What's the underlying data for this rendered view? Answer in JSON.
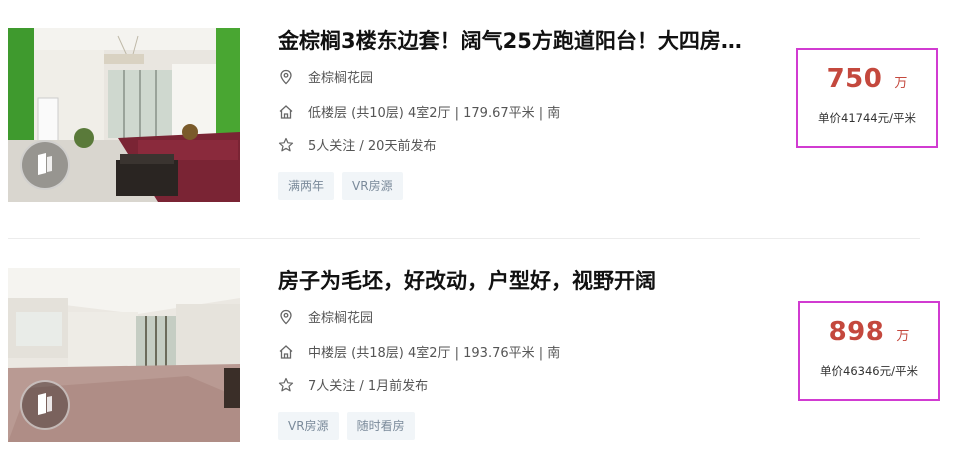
{
  "listings": [
    {
      "title": "金棕榈3楼东边套！阔气25方跑道阳台！大四房…",
      "community": "金棕榈花园",
      "house_info": "低楼层 (共10层) 4室2厅 | 179.67平米 | 南",
      "follow_info": "5人关注 / 20天前发布",
      "tags": [
        "满两年",
        "VR房源"
      ],
      "total_price": "750",
      "total_unit": "万",
      "unit_price": "单价41744元/平米"
    },
    {
      "title": "房子为毛坯，好改动，户型好，视野开阔",
      "community": "金棕榈花园",
      "house_info": "中楼层 (共18层) 4室2厅 | 193.76平米 | 南",
      "follow_info": "7人关注 / 1月前发布",
      "tags": [
        "VR房源",
        "随时看房"
      ],
      "total_price": "898",
      "total_unit": "万",
      "unit_price": "单价46346元/平米"
    }
  ],
  "colors": {
    "price": "#c4483d",
    "highlight_box": "#d13bd1",
    "tag_bg": "#f1f5f8",
    "tag_text": "#7a8a9a"
  },
  "icons": {
    "location": "location-pin-icon",
    "house": "house-icon",
    "follow": "star-icon",
    "vr": "vr-badge-icon"
  }
}
